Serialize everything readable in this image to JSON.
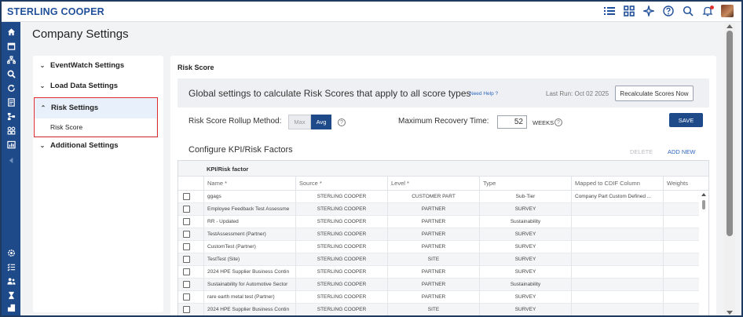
{
  "header": {
    "brand": "STERLING COOPER",
    "icons": [
      "list-icon",
      "grid-icon",
      "sparkle-icon",
      "help-icon",
      "search-icon",
      "bell-icon"
    ]
  },
  "leftnav": {
    "icons": [
      "home-icon",
      "calendar-icon",
      "org-icon",
      "search-icon",
      "refresh-icon",
      "document-icon",
      "hierarchy-icon",
      "modules-icon",
      "report-icon",
      "collapse-icon",
      "settings-icon",
      "checklist-icon",
      "users-icon",
      "hourglass-icon",
      "building-icon"
    ]
  },
  "page_title": "Company Settings",
  "settings_tree": {
    "items": [
      {
        "label": "EventWatch Settings",
        "chevron": "⌄"
      },
      {
        "label": "Load Data Settings",
        "chevron": "⌄"
      },
      {
        "label": "Risk Settings",
        "chevron": "⌃"
      },
      {
        "label": "Additional Settings",
        "chevron": "⌄"
      }
    ],
    "sub_item": "Risk Score"
  },
  "risk_score": {
    "title": "Risk Score",
    "global_text": "Global settings to calculate Risk Scores that apply to all score types",
    "need_help": "Need Help ?",
    "last_run": "Last Run: Oct 02 2025",
    "recalc_label": "Recalculate Scores Now",
    "rollup_label": "Risk Score Rollup Method:",
    "rollup_options": [
      "Max",
      "Avg"
    ],
    "rollup_selected": "Avg",
    "recovery_label": "Maximum Recovery Time:",
    "recovery_value": "52",
    "recovery_unit": "WEEKS",
    "save_label": "SAVE",
    "config_title": "Configure KPI/Risk Factors",
    "delete_label": "DELETE",
    "add_label": "ADD NEW"
  },
  "table": {
    "group_header": "KPI/Risk factor",
    "columns": [
      "Name *",
      "Source *",
      "Level *",
      "Type",
      "Mapped to CDIF Column",
      "Weights"
    ],
    "rows": [
      [
        "ggags",
        "STERLING COOPER",
        "CUSTOMER PART",
        "Sub-Tier",
        "Company Part Custom Defined ...",
        ""
      ],
      [
        "Employee Feedback Test Assessme",
        "STERLING COOPER",
        "PARTNER",
        "SURVEY",
        "",
        ""
      ],
      [
        "RR - Updated",
        "STERLING COOPER",
        "PARTNER",
        "Sustainability",
        "",
        ""
      ],
      [
        "TestAssessment (Partner)",
        "STERLING COOPER",
        "PARTNER",
        "SURVEY",
        "",
        ""
      ],
      [
        "CustomTest (Partner)",
        "STERLING COOPER",
        "PARTNER",
        "SURVEY",
        "",
        ""
      ],
      [
        "TestTest (Site)",
        "STERLING COOPER",
        "SITE",
        "SURVEY",
        "",
        ""
      ],
      [
        "2024 HPE Supplier Business Contin",
        "STERLING COOPER",
        "PARTNER",
        "SURVEY",
        "",
        ""
      ],
      [
        "Sustainability for Automotive Sector",
        "STERLING COOPER",
        "PARTNER",
        "Sustainability",
        "",
        ""
      ],
      [
        "rare earth metal test (Partner)",
        "STERLING COOPER",
        "PARTNER",
        "SURVEY",
        "",
        ""
      ],
      [
        "2024 HPE Supplier Business Contin",
        "STERLING COOPER",
        "SITE",
        "SURVEY",
        "",
        ""
      ]
    ]
  },
  "colors": {
    "brand": "#1f4f9a",
    "nav": "#1e4a8a",
    "highlight_border": "#e0282e",
    "link": "#2f67c2"
  }
}
